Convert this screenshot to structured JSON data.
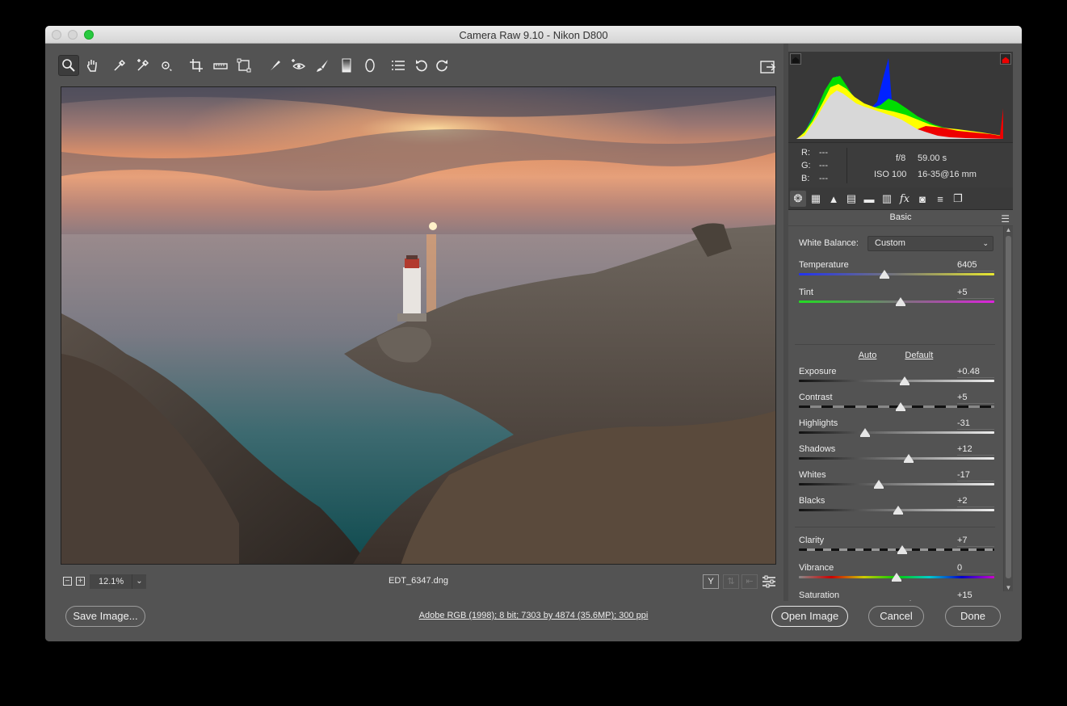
{
  "window": {
    "title": "Camera Raw 9.10  -  Nikon D800"
  },
  "toolbar": {
    "tools": [
      "zoom-icon",
      "hand-icon",
      "white-balance-icon",
      "color-sampler-icon",
      "targeted-adjustment-icon",
      "crop-icon",
      "straighten-icon",
      "transform-icon",
      "spot-removal-icon",
      "red-eye-icon",
      "adjustment-brush-icon",
      "graduated-filter-icon",
      "radial-filter-icon",
      "preferences-icon",
      "rotate-left-icon",
      "rotate-right-icon"
    ],
    "fullscreen": "fullscreen-icon"
  },
  "status": {
    "zoom_out": "−",
    "zoom_in": "+",
    "zoom": "12.1%",
    "filename": "EDT_6347.dng",
    "before_after": "Y"
  },
  "info": {
    "r_label": "R:",
    "r_val": "---",
    "g_label": "G:",
    "g_val": "---",
    "b_label": "B:",
    "b_val": "---",
    "aperture": "f/8",
    "shutter": "59.00 s",
    "iso": "ISO 100",
    "lens": "16-35@16 mm"
  },
  "panel": {
    "title": "Basic",
    "white_balance_label": "White Balance:",
    "white_balance_value": "Custom",
    "auto": "Auto",
    "default": "Default",
    "sliders": [
      {
        "label": "Temperature",
        "value": "6405",
        "pos": 0.44
      },
      {
        "label": "Tint",
        "value": "+5",
        "pos": 0.52
      },
      {
        "label": "Exposure",
        "value": "+0.48",
        "pos": 0.54
      },
      {
        "label": "Contrast",
        "value": "+5",
        "pos": 0.52
      },
      {
        "label": "Highlights",
        "value": "-31",
        "pos": 0.34
      },
      {
        "label": "Shadows",
        "value": "+12",
        "pos": 0.56
      },
      {
        "label": "Whites",
        "value": "-17",
        "pos": 0.41
      },
      {
        "label": "Blacks",
        "value": "+2",
        "pos": 0.51
      },
      {
        "label": "Clarity",
        "value": "+7",
        "pos": 0.53
      },
      {
        "label": "Vibrance",
        "value": "0",
        "pos": 0.5
      },
      {
        "label": "Saturation",
        "value": "+15",
        "pos": 0.57
      }
    ]
  },
  "footer": {
    "save": "Save Image...",
    "workflow": "Adobe RGB (1998); 8 bit; 7303 by 4874 (35.6MP); 300 ppi",
    "open": "Open Image",
    "cancel": "Cancel",
    "done": "Done"
  }
}
